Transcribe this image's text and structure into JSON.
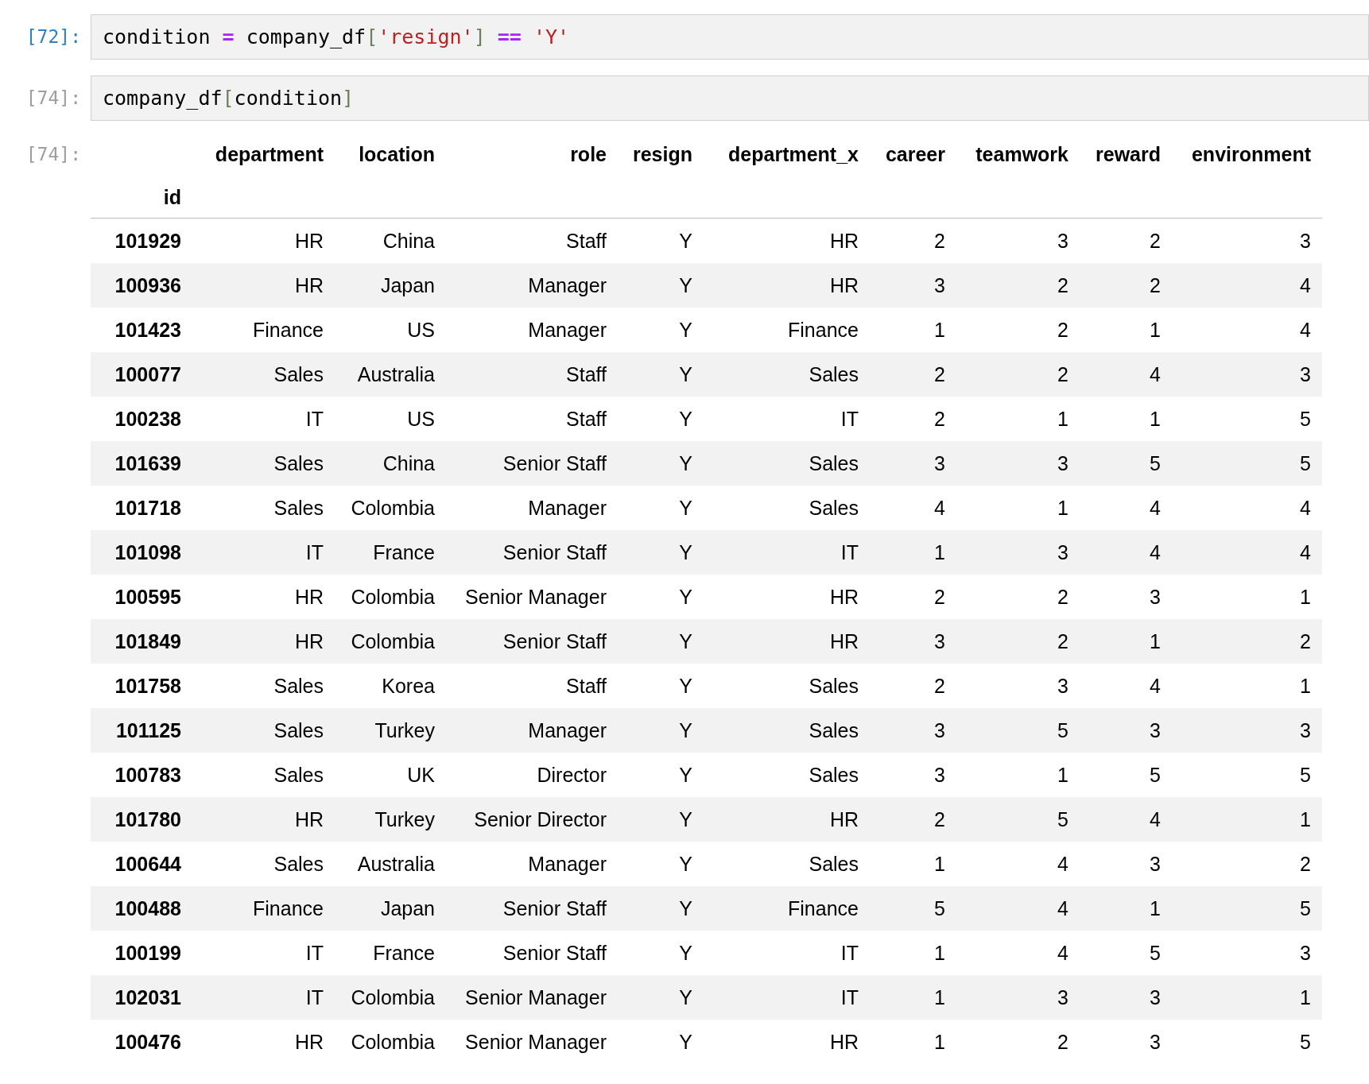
{
  "cells": [
    {
      "prompt": "[72]:",
      "active": true,
      "tokens": [
        {
          "text": "condition ",
          "kind": "name"
        },
        {
          "text": "=",
          "kind": "operator"
        },
        {
          "text": " company_df",
          "kind": "name"
        },
        {
          "text": "[",
          "kind": "bracket"
        },
        {
          "text": "'resign'",
          "kind": "string"
        },
        {
          "text": "]",
          "kind": "bracket"
        },
        {
          "text": " == ",
          "kind": "operator"
        },
        {
          "text": "'Y'",
          "kind": "string"
        }
      ]
    },
    {
      "prompt": "[74]:",
      "active": false,
      "tokens": [
        {
          "text": "company_df",
          "kind": "name"
        },
        {
          "text": "[",
          "kind": "bracket"
        },
        {
          "text": "condition",
          "kind": "name"
        },
        {
          "text": "]",
          "kind": "bracket"
        }
      ]
    }
  ],
  "output": {
    "prompt": "[74]:",
    "table": {
      "columns": [
        "",
        "department",
        "location",
        "role",
        "resign",
        "department_x",
        "career",
        "teamwork",
        "reward",
        "environment"
      ],
      "index_name": "id",
      "rows": [
        [
          "101929",
          "HR",
          "China",
          "Staff",
          "Y",
          "HR",
          "2",
          "3",
          "2",
          "3"
        ],
        [
          "100936",
          "HR",
          "Japan",
          "Manager",
          "Y",
          "HR",
          "3",
          "2",
          "2",
          "4"
        ],
        [
          "101423",
          "Finance",
          "US",
          "Manager",
          "Y",
          "Finance",
          "1",
          "2",
          "1",
          "4"
        ],
        [
          "100077",
          "Sales",
          "Australia",
          "Staff",
          "Y",
          "Sales",
          "2",
          "2",
          "4",
          "3"
        ],
        [
          "100238",
          "IT",
          "US",
          "Staff",
          "Y",
          "IT",
          "2",
          "1",
          "1",
          "5"
        ],
        [
          "101639",
          "Sales",
          "China",
          "Senior Staff",
          "Y",
          "Sales",
          "3",
          "3",
          "5",
          "5"
        ],
        [
          "101718",
          "Sales",
          "Colombia",
          "Manager",
          "Y",
          "Sales",
          "4",
          "1",
          "4",
          "4"
        ],
        [
          "101098",
          "IT",
          "France",
          "Senior Staff",
          "Y",
          "IT",
          "1",
          "3",
          "4",
          "4"
        ],
        [
          "100595",
          "HR",
          "Colombia",
          "Senior Manager",
          "Y",
          "HR",
          "2",
          "2",
          "3",
          "1"
        ],
        [
          "101849",
          "HR",
          "Colombia",
          "Senior Staff",
          "Y",
          "HR",
          "3",
          "2",
          "1",
          "2"
        ],
        [
          "101758",
          "Sales",
          "Korea",
          "Staff",
          "Y",
          "Sales",
          "2",
          "3",
          "4",
          "1"
        ],
        [
          "101125",
          "Sales",
          "Turkey",
          "Manager",
          "Y",
          "Sales",
          "3",
          "5",
          "3",
          "3"
        ],
        [
          "100783",
          "Sales",
          "UK",
          "Director",
          "Y",
          "Sales",
          "3",
          "1",
          "5",
          "5"
        ],
        [
          "101780",
          "HR",
          "Turkey",
          "Senior Director",
          "Y",
          "HR",
          "2",
          "5",
          "4",
          "1"
        ],
        [
          "100644",
          "Sales",
          "Australia",
          "Manager",
          "Y",
          "Sales",
          "1",
          "4",
          "3",
          "2"
        ],
        [
          "100488",
          "Finance",
          "Japan",
          "Senior Staff",
          "Y",
          "Finance",
          "5",
          "4",
          "1",
          "5"
        ],
        [
          "100199",
          "IT",
          "France",
          "Senior Staff",
          "Y",
          "IT",
          "1",
          "4",
          "5",
          "3"
        ],
        [
          "102031",
          "IT",
          "Colombia",
          "Senior Manager",
          "Y",
          "IT",
          "1",
          "3",
          "3",
          "1"
        ],
        [
          "100476",
          "HR",
          "Colombia",
          "Senior Manager",
          "Y",
          "HR",
          "1",
          "2",
          "3",
          "5"
        ]
      ]
    }
  }
}
